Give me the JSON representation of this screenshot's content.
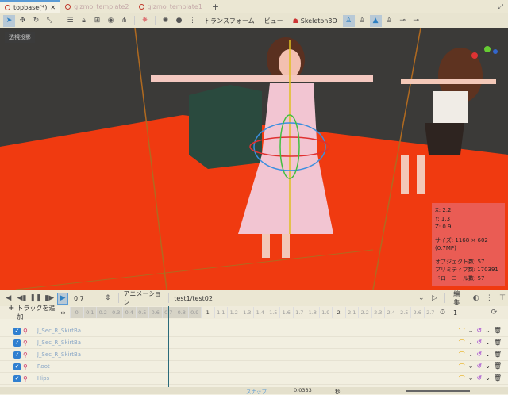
{
  "tabs": [
    {
      "label": "topbase(*)",
      "active": true
    },
    {
      "label": "gizmo_template2"
    },
    {
      "label": "gizmo_template1"
    }
  ],
  "toolbar": {
    "transform_label": "トランスフォーム",
    "view_label": "ビュー",
    "skeleton_label": "Skeleton3D"
  },
  "viewport": {
    "perspective_label": "透視投影",
    "stats": {
      "x": "X: 2.2",
      "y": "Y: 1.3",
      "z": "Z: 0.9",
      "size": "サイズ: 1168 × 602 (0.7MP)",
      "objects": "オブジェクト数: 57",
      "primitives": "プリミティブ数: 170391",
      "drawcalls": "ドローコール数: 57"
    }
  },
  "animation": {
    "time": "0.7",
    "label": "アニメーション",
    "current": "test1/test02",
    "edit_label": "編集",
    "add_track": "トラックを追加",
    "end_value": "1"
  },
  "timeline": {
    "ticks": [
      "0",
      "0.1",
      "0.2",
      "0.3",
      "0.4",
      "0.5",
      "0.6",
      "0.7",
      "0.8",
      "0.9",
      "1",
      "1.1",
      "1.2",
      "1.3",
      "1.4",
      "1.5",
      "1.6",
      "1.7",
      "1.8",
      "1.9",
      "2",
      "2.1",
      "2.2",
      "2.3",
      "2.4",
      "2.5",
      "2.6",
      "2.7"
    ],
    "playhead": 0.7
  },
  "tracks": [
    {
      "name": "J_Sec_R_SkirtBa"
    },
    {
      "name": "J_Sec_R_SkirtBa"
    },
    {
      "name": "J_Sec_R_SkirtBa"
    },
    {
      "name": "Root"
    },
    {
      "name": "Hips"
    }
  ],
  "bottom": {
    "snap_label": "スナップ",
    "snap_value": "0.0333",
    "unit": "秒"
  }
}
